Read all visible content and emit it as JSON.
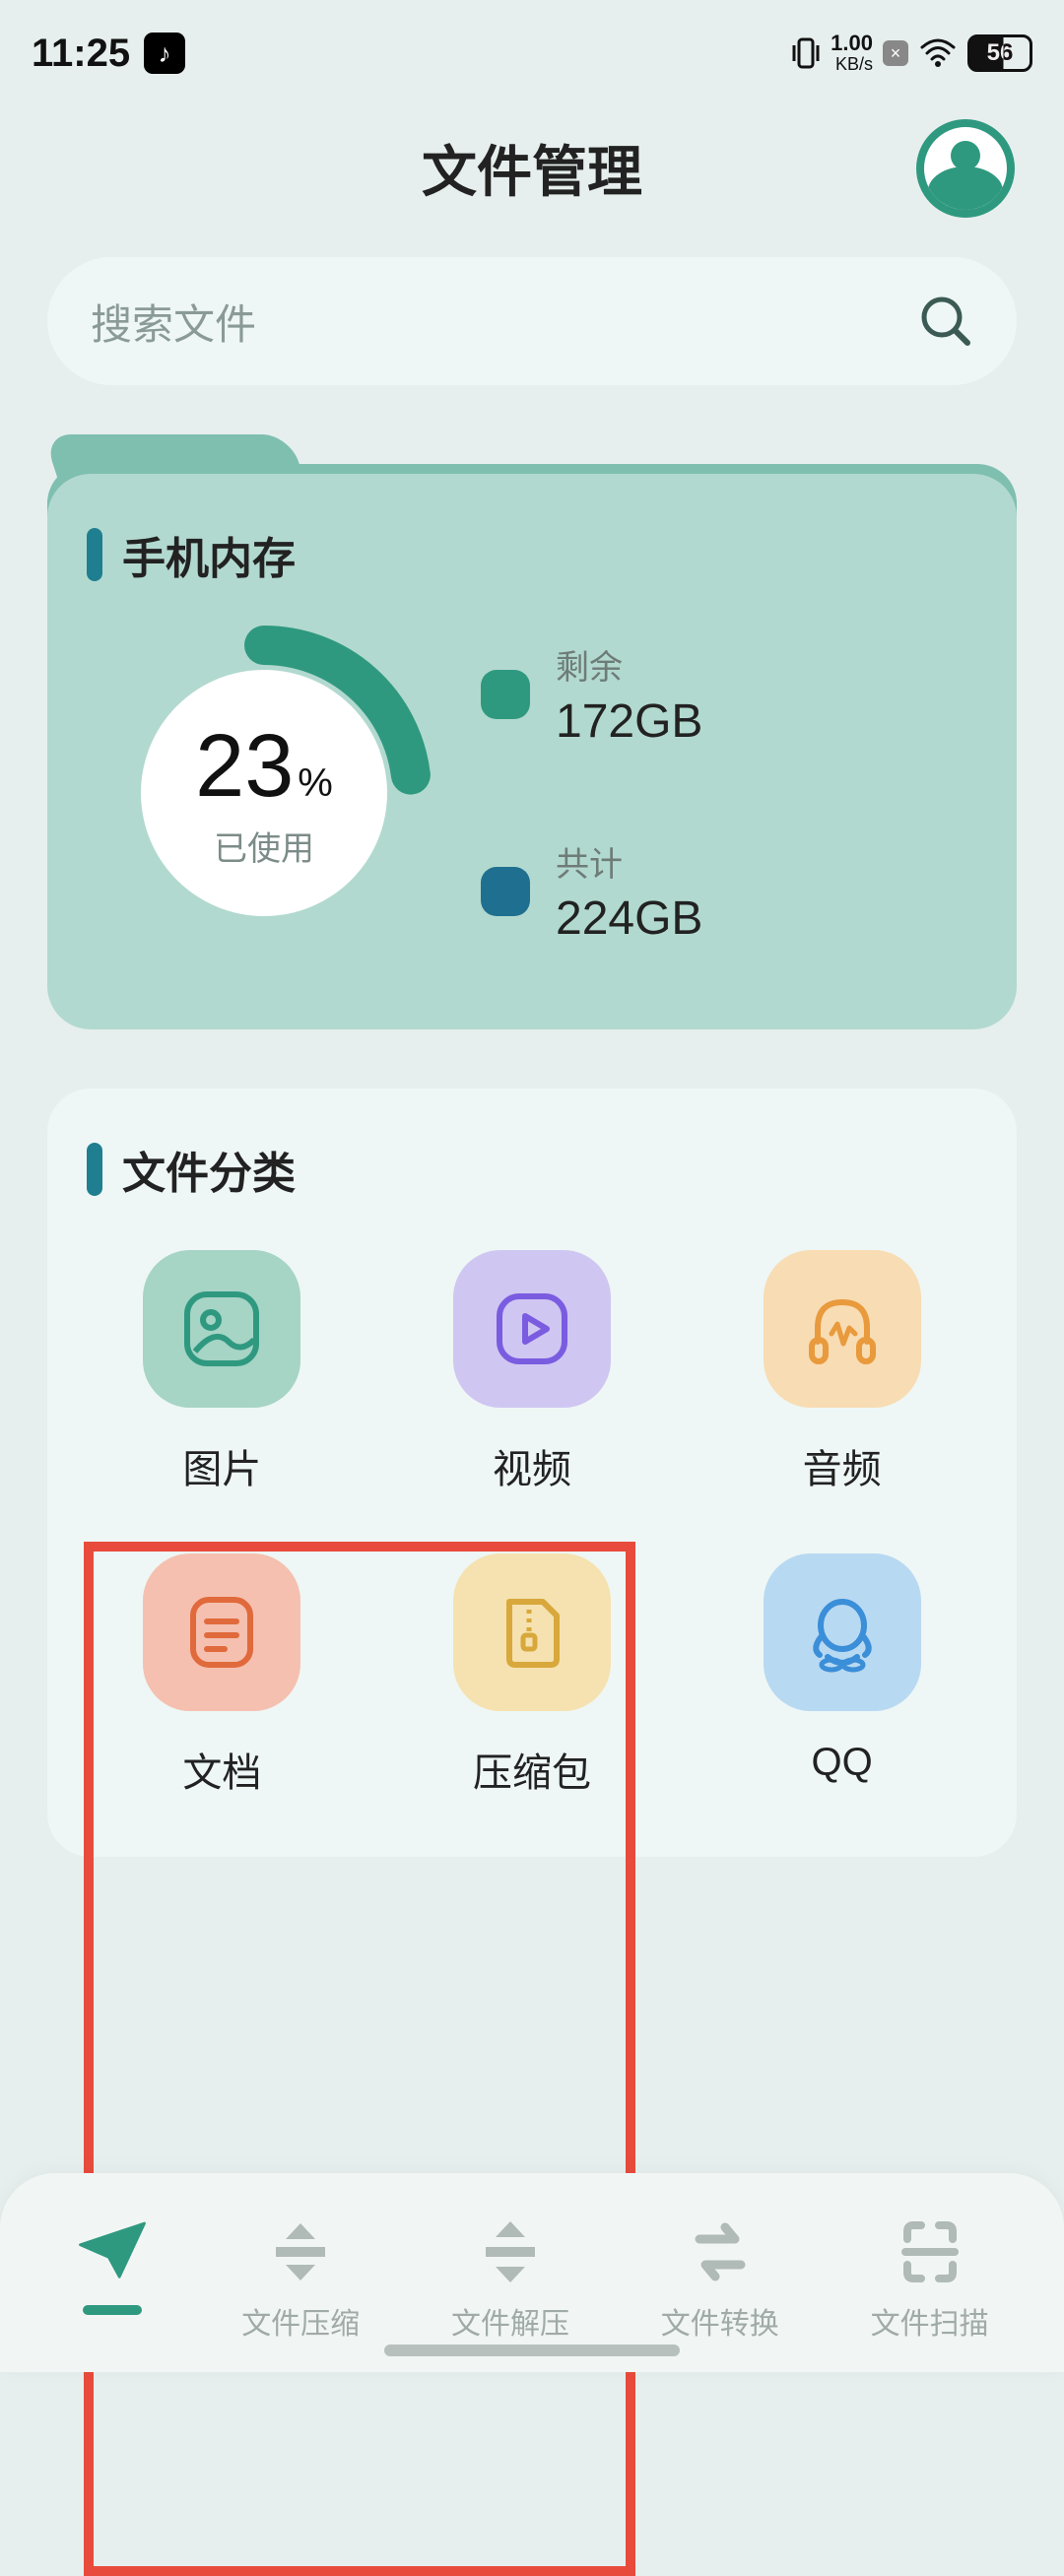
{
  "status": {
    "time": "11:25",
    "net_speed_value": "1.00",
    "net_speed_unit": "KB/s",
    "battery": "56"
  },
  "header": {
    "title": "文件管理"
  },
  "search": {
    "placeholder": "搜索文件"
  },
  "storage": {
    "title": "手机内存",
    "percent_value": "23",
    "percent_symbol": "%",
    "used_label": "已使用",
    "remaining_label": "剩余",
    "remaining_value": "172GB",
    "total_label": "共计",
    "total_value": "224GB",
    "percent_numeric": 23
  },
  "categories": {
    "title": "文件分类",
    "items": [
      {
        "label": "图片"
      },
      {
        "label": "视频"
      },
      {
        "label": "音频"
      },
      {
        "label": "文档"
      },
      {
        "label": "压缩包"
      },
      {
        "label": "QQ"
      }
    ]
  },
  "nav": {
    "items": [
      {
        "label": ""
      },
      {
        "label": "文件压缩"
      },
      {
        "label": "文件解压"
      },
      {
        "label": "文件转换"
      },
      {
        "label": "文件扫描"
      }
    ]
  },
  "highlight": {
    "present": true,
    "description": "red rectangle overlay around upper-left file categories area"
  }
}
